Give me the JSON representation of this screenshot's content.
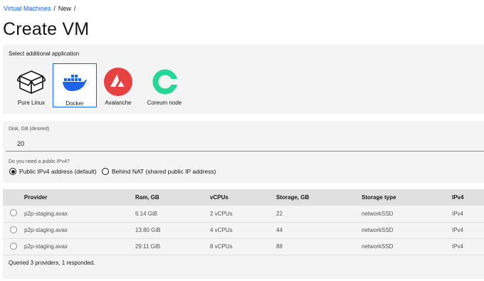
{
  "breadcrumb": {
    "parent": "Virtual Machines",
    "current": "New",
    "separator": "/"
  },
  "page_title": "Create VM",
  "applications": {
    "label": "Select additional application",
    "items": [
      {
        "name": "Pure Linux",
        "icon": "box-icon"
      },
      {
        "name": "Docker",
        "icon": "docker-whale-icon",
        "selected": true
      },
      {
        "name": "Avalanche",
        "icon": "avalanche-logo-icon"
      },
      {
        "name": "Coreum node",
        "icon": "coreum-logo-icon"
      }
    ]
  },
  "disk": {
    "label": "Disk, GB (desired)",
    "value": "20"
  },
  "ipv4": {
    "label": "Do you need a public IPv4?",
    "options": [
      {
        "label": "Public IPv4 address (default)",
        "checked": true
      },
      {
        "label": "Behind NAT (shared public IP address)",
        "checked": false
      }
    ]
  },
  "table": {
    "headers": [
      "Provider",
      "Ram, GB",
      "vCPUs",
      "Storage, GB",
      "Storage type",
      "IPv4"
    ],
    "rows": [
      [
        "p2p-staging.avax",
        "6.14 GiB",
        "2 vCPUs",
        "22",
        "networkSSD",
        "IPv4"
      ],
      [
        "p2p-staging.avax",
        "13.80 GiB",
        "4 vCPUs",
        "44",
        "networkSSD",
        "IPv4"
      ],
      [
        "p2p-staging.avax",
        "29.11 GiB",
        "8 vCPUs",
        "88",
        "networkSSD",
        "IPv4"
      ]
    ],
    "footer": "Queried 3 providers, 1 responded."
  },
  "colors": {
    "accent": "#0f62fe",
    "docker": "#1d63ed",
    "avalanche": "#e84142",
    "coreum": "#25d695"
  }
}
